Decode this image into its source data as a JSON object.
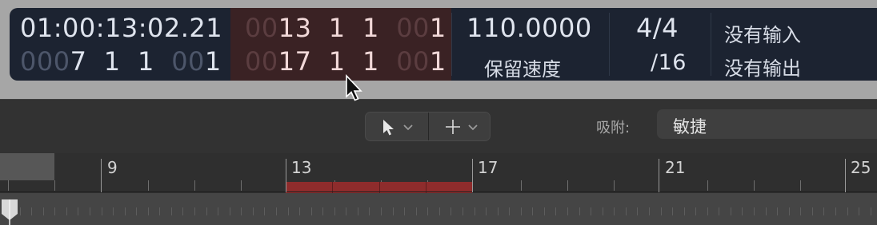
{
  "lcd": {
    "time_clock": "01:00:13:02.21",
    "time_position": {
      "dim": "000",
      "value": "7  1  1",
      "dim2": "00",
      "value2": "1"
    },
    "cycle_start": {
      "dim": "00",
      "value": "13  1  1",
      "dim2": "00",
      "value2": "1"
    },
    "cycle_end": {
      "dim": "00",
      "value": "17  1  1",
      "dim2": "00",
      "value2": "1"
    },
    "tempo": "110.0000",
    "tempo_label": "保留速度",
    "signature": "4/4",
    "division": "/16",
    "midi_in": "没有输入",
    "midi_out": "没有输出"
  },
  "toolbar": {
    "pointer_tool_icon": "arrow-pointer-icon",
    "secondary_tool_icon": "crosshair-icon",
    "snap_label": "吸附:",
    "snap_value": "敏捷"
  },
  "ruler": {
    "bars": [
      "9",
      "13",
      "17",
      "21",
      "25"
    ]
  },
  "colors": {
    "lcd_background": "#1c2331",
    "cycle_background": "#3a2224",
    "cycle_region": "#8e2c2c"
  }
}
